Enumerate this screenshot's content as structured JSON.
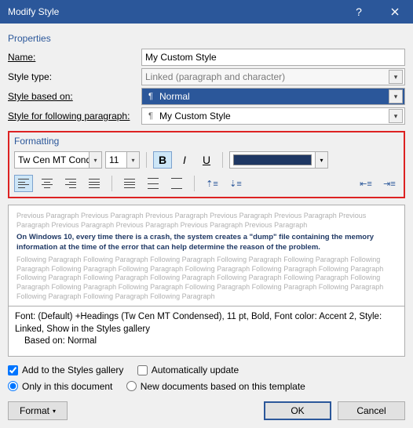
{
  "window": {
    "title": "Modify Style"
  },
  "properties": {
    "heading": "Properties",
    "name_label": "Name:",
    "name_value": "My Custom Style",
    "styletype_label": "Style type:",
    "styletype_value": "Linked (paragraph and character)",
    "basedon_label": "Style based on:",
    "basedon_value": "Normal",
    "following_label": "Style for following paragraph:",
    "following_value": "My Custom Style"
  },
  "formatting": {
    "heading": "Formatting",
    "font_name": "Tw Cen MT Condensed",
    "font_size": "11",
    "bold": "B",
    "italic": "I",
    "underline": "U",
    "color": "#1f3864"
  },
  "preview": {
    "prev_para": "Previous Paragraph Previous Paragraph Previous Paragraph Previous Paragraph Previous Paragraph Previous Paragraph Previous Paragraph Previous Paragraph Previous Paragraph Previous Paragraph",
    "sample": "On Windows 10, every time there is a crash, the system creates a \"dump\" file containing the memory information at the time of the error that can help determine the reason of the problem.",
    "next_para": "Following Paragraph Following Paragraph Following Paragraph Following Paragraph Following Paragraph Following Paragraph Following Paragraph Following Paragraph Following Paragraph Following Paragraph Following Paragraph Following Paragraph Following Paragraph Following Paragraph Following Paragraph Following Paragraph Following Paragraph Following Paragraph Following Paragraph Following Paragraph Following Paragraph Following Paragraph Following Paragraph Following Paragraph Following Paragraph"
  },
  "description": {
    "line1": "Font: (Default) +Headings (Tw Cen MT Condensed), 11 pt, Bold, Font color: Accent 2, Style: Linked, Show in the Styles gallery",
    "line2": "Based on: Normal"
  },
  "options": {
    "add_gallery": "Add to the Styles gallery",
    "auto_update": "Automatically update",
    "only_doc": "Only in this document",
    "new_docs": "New documents based on this template"
  },
  "footer": {
    "format": "Format",
    "ok": "OK",
    "cancel": "Cancel"
  }
}
